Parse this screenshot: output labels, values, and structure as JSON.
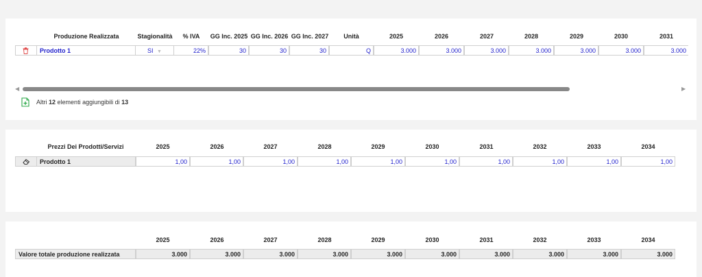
{
  "section1": {
    "headers": {
      "prod": "Produzione Realizzata",
      "stag": "Stagionalità",
      "iva": "% IVA",
      "gg2025": "GG Inc. 2025",
      "gg2026": "GG Inc. 2026",
      "gg2027": "GG Inc. 2027",
      "unit": "Unità",
      "years": [
        "2025",
        "2026",
        "2027",
        "2028",
        "2029",
        "2030",
        "2031"
      ]
    },
    "row": {
      "name": "Prodotto 1",
      "stag": "SI",
      "iva": "22%",
      "gg2025": "30",
      "gg2026": "30",
      "gg2027": "30",
      "unit": "Q",
      "values": [
        "3.000",
        "3.000",
        "3.000",
        "3.000",
        "3.000",
        "3.000",
        "3.000"
      ]
    },
    "footer": {
      "prefix": "Altri",
      "count": "12",
      "middle": "elementi aggiungibili di",
      "total": "13"
    }
  },
  "section2": {
    "title": "Prezzi Dei Prodotti/Servizi",
    "years": [
      "2025",
      "2026",
      "2027",
      "2028",
      "2029",
      "2030",
      "2031",
      "2032",
      "2033",
      "2034"
    ],
    "row": {
      "name": "Prodotto 1",
      "values": [
        "1,00",
        "1,00",
        "1,00",
        "1,00",
        "1,00",
        "1,00",
        "1,00",
        "1,00",
        "1,00",
        "1,00"
      ]
    }
  },
  "section3": {
    "years": [
      "2025",
      "2026",
      "2027",
      "2028",
      "2029",
      "2030",
      "2031",
      "2032",
      "2033",
      "2034"
    ],
    "row": {
      "name": "Valore totale produzione realizzata",
      "values": [
        "3.000",
        "3.000",
        "3.000",
        "3.000",
        "3.000",
        "3.000",
        "3.000",
        "3.000",
        "3.000",
        "3.000"
      ]
    }
  },
  "colors": {
    "blue": "#2222cc",
    "trash": "#e04848",
    "add": "#28a745"
  },
  "icons": {
    "delete": "trash-icon",
    "add": "add-file-icon",
    "erase": "eraser-icon",
    "stag": "dropdown-icon"
  }
}
